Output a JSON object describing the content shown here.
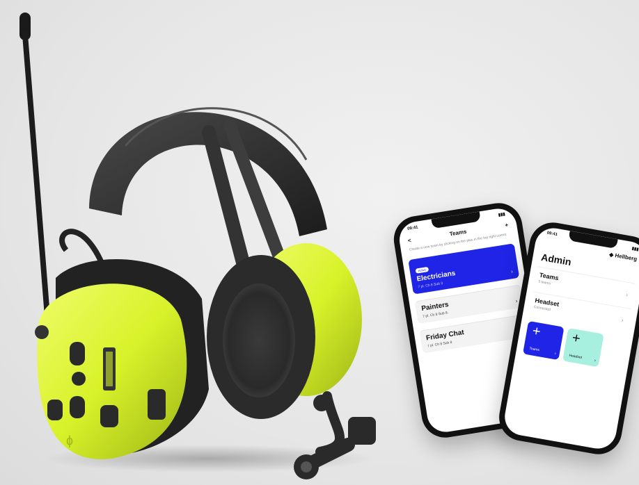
{
  "phone_teams": {
    "status_time": "09:41",
    "title": "Teams",
    "add_label": "+",
    "back_label": "<",
    "hint": "Create a new team by clicking on the plus in the top right corner.",
    "teams": [
      {
        "badge": "Active",
        "name": "Electricians",
        "meta": "7 pl.   Ch 8  Sub 3",
        "active": true
      },
      {
        "name": "Painters",
        "meta": "7 pl.   Ch 8  Sub 8",
        "active": false
      },
      {
        "name": "Friday Chat",
        "meta": "7 pl.   Ch 8  Sub 8",
        "active": false
      }
    ]
  },
  "phone_admin": {
    "status_time": "09:41",
    "brand": "Hellberg",
    "title": "Admin",
    "rows": [
      {
        "label": "Teams",
        "sub": "3 teams"
      },
      {
        "label": "Headset",
        "sub": "Connected"
      }
    ],
    "tiles": [
      {
        "plus": "+",
        "label": "Teams",
        "style": "blue"
      },
      {
        "plus": "+",
        "label": "Headset",
        "style": "mint"
      }
    ]
  },
  "colors": {
    "accent_blue": "#1f24e6",
    "mint": "#a7f0e0",
    "hiviz_yellow": "#d8f22a",
    "headset_dark": "#2a2a2a"
  }
}
